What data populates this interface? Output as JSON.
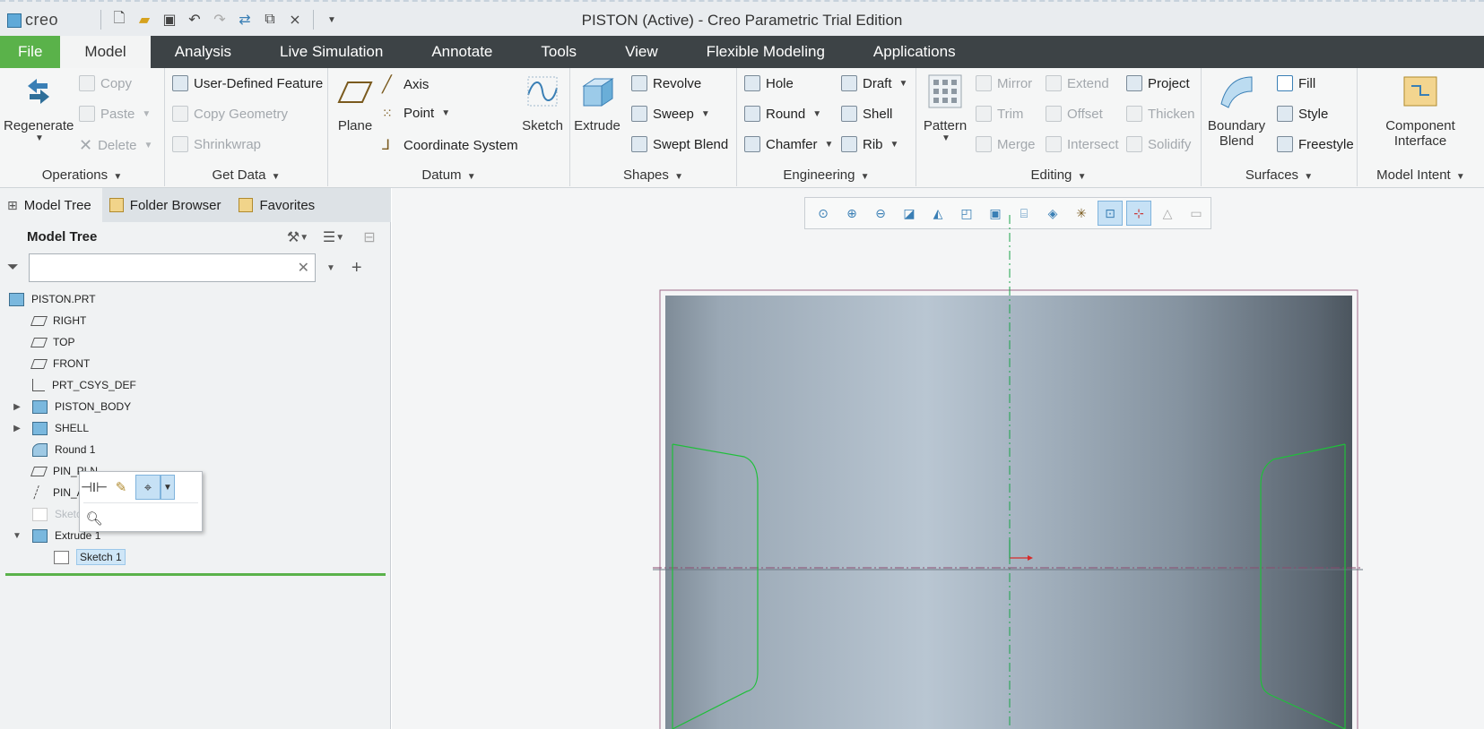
{
  "app": {
    "logo_text": "creo",
    "window_title": "PISTON (Active) - Creo Parametric Trial Edition"
  },
  "quick_access": [
    "new-icon",
    "open-icon",
    "save-icon",
    "undo-icon",
    "redo-icon",
    "regenerate-icon",
    "windows-icon",
    "close-icon",
    "customize-icon"
  ],
  "ribbon_tabs": [
    "File",
    "Model",
    "Analysis",
    "Live Simulation",
    "Annotate",
    "Tools",
    "View",
    "Flexible Modeling",
    "Applications"
  ],
  "active_tab": "Model",
  "ribbon": {
    "operations": {
      "label": "Operations",
      "regenerate": "Regenerate",
      "copy": "Copy",
      "paste": "Paste",
      "delete": "Delete"
    },
    "get_data": {
      "label": "Get Data",
      "udf": "User-Defined Feature",
      "copy_geometry": "Copy Geometry",
      "shrinkwrap": "Shrinkwrap"
    },
    "datum": {
      "label": "Datum",
      "plane": "Plane",
      "axis": "Axis",
      "point": "Point",
      "csys": "Coordinate System",
      "sketch": "Sketch"
    },
    "shapes": {
      "label": "Shapes",
      "extrude": "Extrude",
      "revolve": "Revolve",
      "sweep": "Sweep",
      "swept_blend": "Swept Blend"
    },
    "engineering": {
      "label": "Engineering",
      "hole": "Hole",
      "round": "Round",
      "chamfer": "Chamfer",
      "draft": "Draft",
      "shell": "Shell",
      "rib": "Rib"
    },
    "editing": {
      "label": "Editing",
      "pattern": "Pattern",
      "mirror": "Mirror",
      "trim": "Trim",
      "merge": "Merge",
      "extend": "Extend",
      "offset": "Offset",
      "intersect": "Intersect",
      "project": "Project",
      "thicken": "Thicken",
      "solidify": "Solidify"
    },
    "surfaces": {
      "label": "Surfaces",
      "boundary_blend_1": "Boundary",
      "boundary_blend_2": "Blend",
      "fill": "Fill",
      "style": "Style",
      "freestyle": "Freestyle"
    },
    "model_intent": {
      "label": "Model Intent",
      "component_interface_1": "Component",
      "component_interface_2": "Interface"
    }
  },
  "panel": {
    "tabs": [
      "Model Tree",
      "Folder Browser",
      "Favorites"
    ],
    "title": "Model Tree",
    "search_value": "",
    "tree": [
      {
        "label": "PISTON.PRT",
        "icon": "part-icon",
        "depth": 0,
        "expander": ""
      },
      {
        "label": "RIGHT",
        "icon": "datum-plane-icon",
        "depth": 1,
        "expander": ""
      },
      {
        "label": "TOP",
        "icon": "datum-plane-icon",
        "depth": 1,
        "expander": ""
      },
      {
        "label": "FRONT",
        "icon": "datum-plane-icon",
        "depth": 1,
        "expander": ""
      },
      {
        "label": "PRT_CSYS_DEF",
        "icon": "csys-icon",
        "depth": 1,
        "expander": ""
      },
      {
        "label": "PISTON_BODY",
        "icon": "feature-icon",
        "depth": 1,
        "expander": "▶"
      },
      {
        "label": "SHELL",
        "icon": "feature-icon",
        "depth": 1,
        "expander": "▶"
      },
      {
        "label": "Round 1",
        "icon": "round-icon",
        "depth": 1,
        "expander": ""
      },
      {
        "label": "PIN_PLN",
        "icon": "datum-plane-icon",
        "depth": 1,
        "expander": ""
      },
      {
        "label": "PIN_A",
        "icon": "datum-axis-icon",
        "depth": 1,
        "expander": ""
      },
      {
        "label": "Sketch",
        "icon": "sketch-icon",
        "depth": 1,
        "expander": "",
        "dim": true
      },
      {
        "label": "Extrude 1",
        "icon": "feature-icon",
        "depth": 1,
        "expander": "▼"
      },
      {
        "label": "Sketch 1",
        "icon": "sketch-icon",
        "depth": 2,
        "expander": "",
        "selected": true
      }
    ]
  },
  "mini_toolbar": [
    "edit-dimensions-icon",
    "edit-definition-icon",
    "select-icon",
    "dropdown-icon",
    "zoom-to-selected-icon"
  ],
  "view_toolbar": [
    "refit-icon",
    "zoom-in-icon",
    "zoom-out-icon",
    "repaint-icon",
    "display-style-icon",
    "saved-orientations-icon",
    "named-views-icon",
    "perspective-icon",
    "section-icon",
    "datum-display-icon",
    "annotation-display-icon",
    "spin-center-icon",
    "appearance-icon",
    "layer-icon"
  ]
}
